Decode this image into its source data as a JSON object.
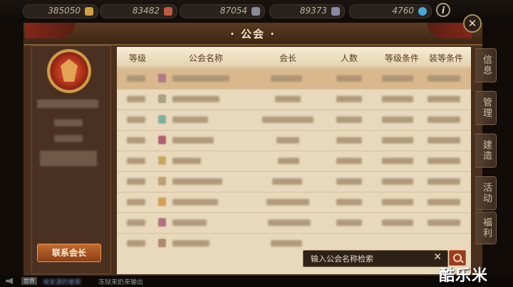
{
  "resources": [
    {
      "name": "gold",
      "value": "385050",
      "color": "#d0a040",
      "icon": "gold-bars-icon"
    },
    {
      "name": "crystal",
      "value": "83482",
      "color": "#c05a40",
      "icon": "ore-icon"
    },
    {
      "name": "metal",
      "value": "87054",
      "color": "#8a8a9a",
      "icon": "metal-icon"
    },
    {
      "name": "stone",
      "value": "89373",
      "color": "#8a8aa8",
      "icon": "stone-icon"
    },
    {
      "name": "gem",
      "value": "4760",
      "color": "#4aa8d8",
      "icon": "gem-icon"
    }
  ],
  "info_button": "i",
  "window": {
    "title": "· 公会 ·",
    "close": "✕"
  },
  "left_panel": {
    "contact_button": "联系会长"
  },
  "table": {
    "columns": [
      "等级",
      "公会名称",
      "会长",
      "人数",
      "等级条件",
      "装等条件"
    ]
  },
  "search": {
    "placeholder": "输入公会名称检索",
    "clear": "✕"
  },
  "right_tabs": [
    "信息",
    "管理",
    "建造",
    "活动",
    "福利"
  ],
  "chat": {
    "channel": "世界",
    "sender": "埃安源的崔斯",
    "message": "冻狱来奶来输出"
  },
  "watermark": "酷乐米",
  "colors": {
    "accent": "#c46a2e",
    "header_bg": "#5b3a22",
    "table_bg": "#e8d9bc",
    "selected_row": "#d8b88c"
  }
}
